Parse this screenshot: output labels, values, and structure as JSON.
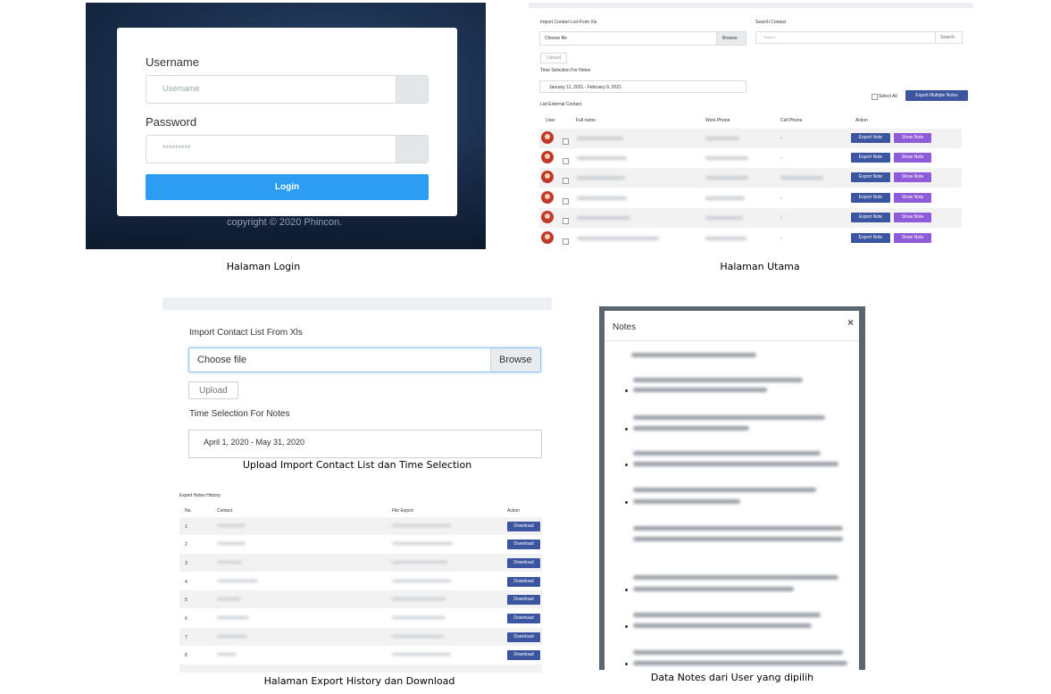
{
  "captions": {
    "login": "Halaman Login",
    "main": "Halaman Utama",
    "upload": "Upload Import Contact List dan Time Selection",
    "export": "Halaman Export History dan Download",
    "notes": "Data Notes dari User yang dipilih"
  },
  "login": {
    "username_label": "Username",
    "username_placeholder": "Username",
    "password_label": "Password",
    "password_placeholder": "*********",
    "login_button": "Login",
    "copyright": "copyright © 2020 Phincon."
  },
  "main": {
    "import_label": "Import Contact List From Xls",
    "choose_file": "Choose file",
    "browse": "Browse",
    "upload": "Upload",
    "time_label": "Time Selection For Notes",
    "date_range": "January 11, 2021 - February 9, 2021",
    "search_label": "Search Contact",
    "search_placeholder": "Search",
    "search_button": "Search",
    "select_all": "Select All",
    "export_multiple": "Export Multiple Notes",
    "list_title": "List External Contact",
    "columns": [
      "User",
      "Full name",
      "Work Phone",
      "Cell Phone",
      "Action"
    ],
    "cell_dash": "-",
    "export_note": "Export Note",
    "show_note": "Show Note"
  },
  "upload": {
    "import_label": "Import Contact List From Xls",
    "choose_file": "Choose file",
    "browse": "Browse",
    "upload": "Upload",
    "time_label": "Time Selection For Notes",
    "date_range": "April 1, 2020 - May 31, 2020"
  },
  "export": {
    "title": "Export Notes History",
    "columns": [
      "No.",
      "Contact",
      "File Export",
      "Action"
    ],
    "rows": [
      "1",
      "2",
      "3",
      "4",
      "5",
      "6",
      "7",
      "8"
    ],
    "download": "Download"
  },
  "notes": {
    "title": "Notes",
    "close": "×"
  },
  "colors": {
    "login_blue": "#2d9cf3",
    "export_note": "#3b55a0",
    "show_note": "#8e5cd9"
  }
}
